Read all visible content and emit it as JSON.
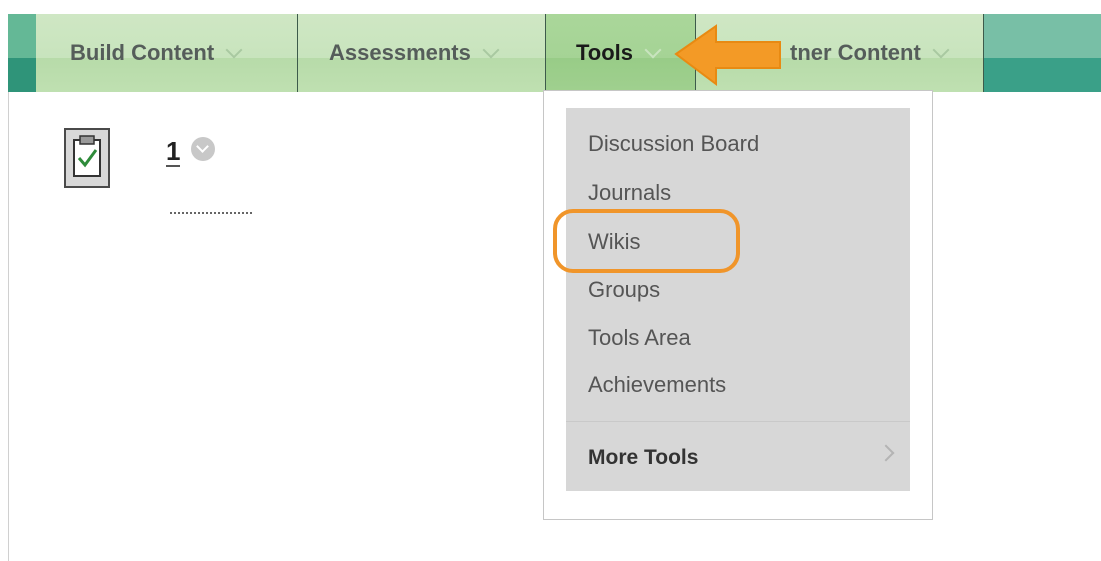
{
  "toolbar": {
    "tabs": [
      {
        "label": "Build Content"
      },
      {
        "label": "Assessments"
      },
      {
        "label": "Tools"
      },
      {
        "label": "Partner Content",
        "visible_label": "tner Content"
      }
    ]
  },
  "content_item": {
    "title": "1",
    "icon": "clipboard-check-icon"
  },
  "tools_menu": {
    "items": [
      {
        "label": "Discussion Board"
      },
      {
        "label": "Journals"
      },
      {
        "label": "Wikis",
        "highlighted": true
      },
      {
        "label": "Groups"
      },
      {
        "label": "Tools Area"
      },
      {
        "label": "Achievements"
      }
    ],
    "more_tools": "More Tools"
  },
  "colors": {
    "toolbar_dark": "#3aa088",
    "tab_light": "#cfe7c4",
    "active_tab": "#aad79a",
    "menu_bg": "#d7d7d7",
    "annotation": "#f0952a"
  }
}
